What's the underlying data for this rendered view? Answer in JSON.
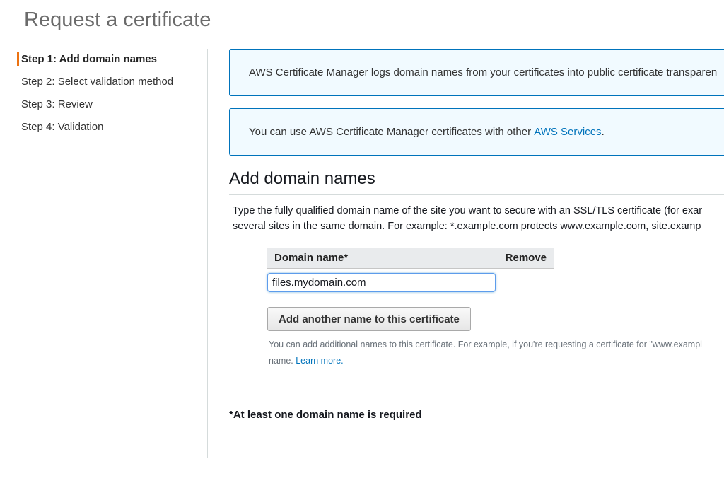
{
  "page": {
    "title": "Request a certificate"
  },
  "steps": [
    {
      "label": "Step 1: Add domain names",
      "active": true
    },
    {
      "label": "Step 2: Select validation method",
      "active": false
    },
    {
      "label": "Step 3: Review",
      "active": false
    },
    {
      "label": "Step 4: Validation",
      "active": false
    }
  ],
  "info": {
    "transparency_text": "AWS Certificate Manager logs domain names from your certificates into public certificate transparen",
    "services_text": "You can use AWS Certificate Manager certificates with other ",
    "services_link": "AWS Services",
    "services_suffix": "."
  },
  "section": {
    "title": "Add domain names",
    "desc_line1": "Type the fully qualified domain name of the site you want to secure with an SSL/TLS certificate (for exar",
    "desc_line2": "several sites in the same domain. For example: *.example.com protects www.example.com, site.examp"
  },
  "table": {
    "col_domain": "Domain name*",
    "col_remove": "Remove",
    "domain_value": "files.mydomain.com"
  },
  "actions": {
    "add_label": "Add another name to this certificate",
    "hint_line1": "You can add additional names to this certificate. For example, if you're requesting a certificate for \"www.exampl",
    "hint_line2_prefix": "name. ",
    "learn_more": "Learn more."
  },
  "footer": {
    "required_note": "*At least one domain name is required"
  },
  "colors": {
    "accent": "#ec7211",
    "link": "#0073bb",
    "info_bg": "#f1faff"
  }
}
